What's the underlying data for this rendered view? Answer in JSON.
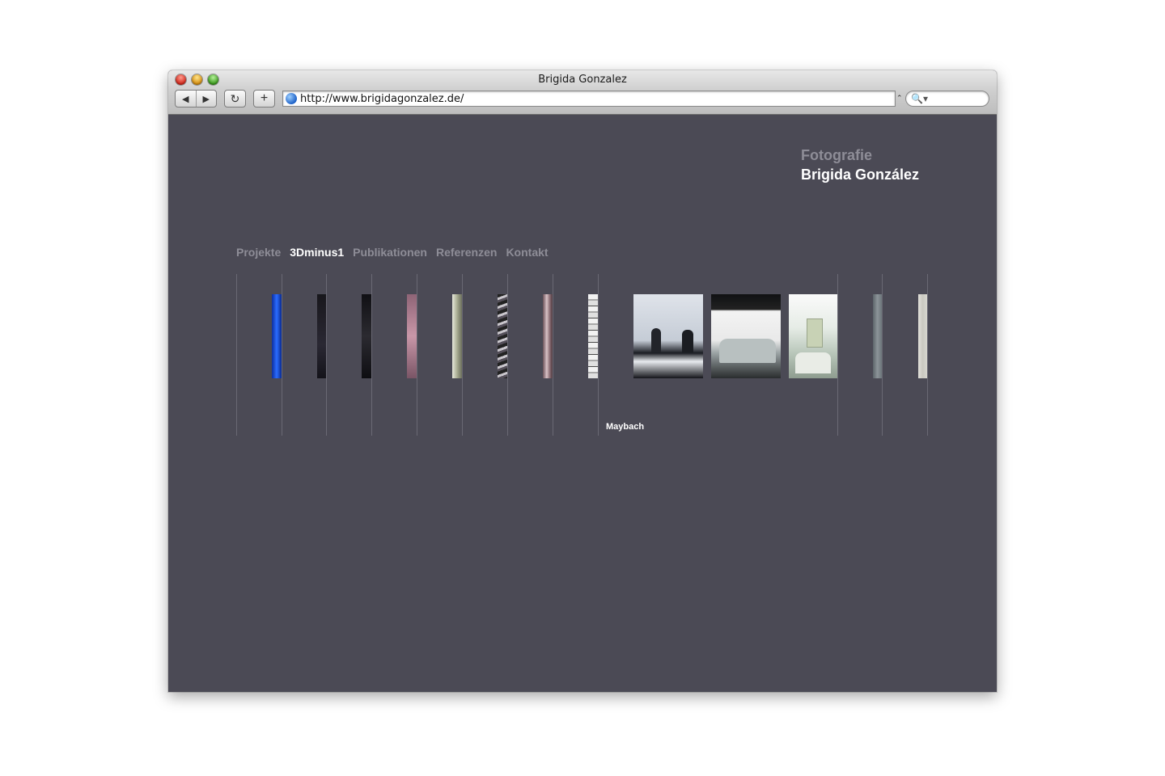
{
  "browser": {
    "window_title": "Brigida Gonzalez",
    "url": "http://www.brigidagonzalez.de/",
    "back_glyph": "◀",
    "forward_glyph": "▶",
    "reload_glyph": "↻",
    "add_glyph": "+",
    "search_glyph": "🔍▾"
  },
  "site": {
    "brand_line1": "Fotografie",
    "brand_line2": "Brigida González",
    "nav": [
      "Projekte",
      "3Dminus1",
      "Publikationen",
      "Referenzen",
      "Kontakt"
    ],
    "active_nav": "3Dminus1",
    "gallery": {
      "strip_colors": [
        "#1a4fd6",
        "#1f1d24",
        "#16151a",
        "#b58a9a",
        "#b8bba6",
        "#6b6570",
        "#a88e93",
        "#d9d9d9",
        "#6b7077",
        "#c9c8c2"
      ],
      "expanded_project": "Maybach",
      "caption": "Maybach"
    }
  }
}
